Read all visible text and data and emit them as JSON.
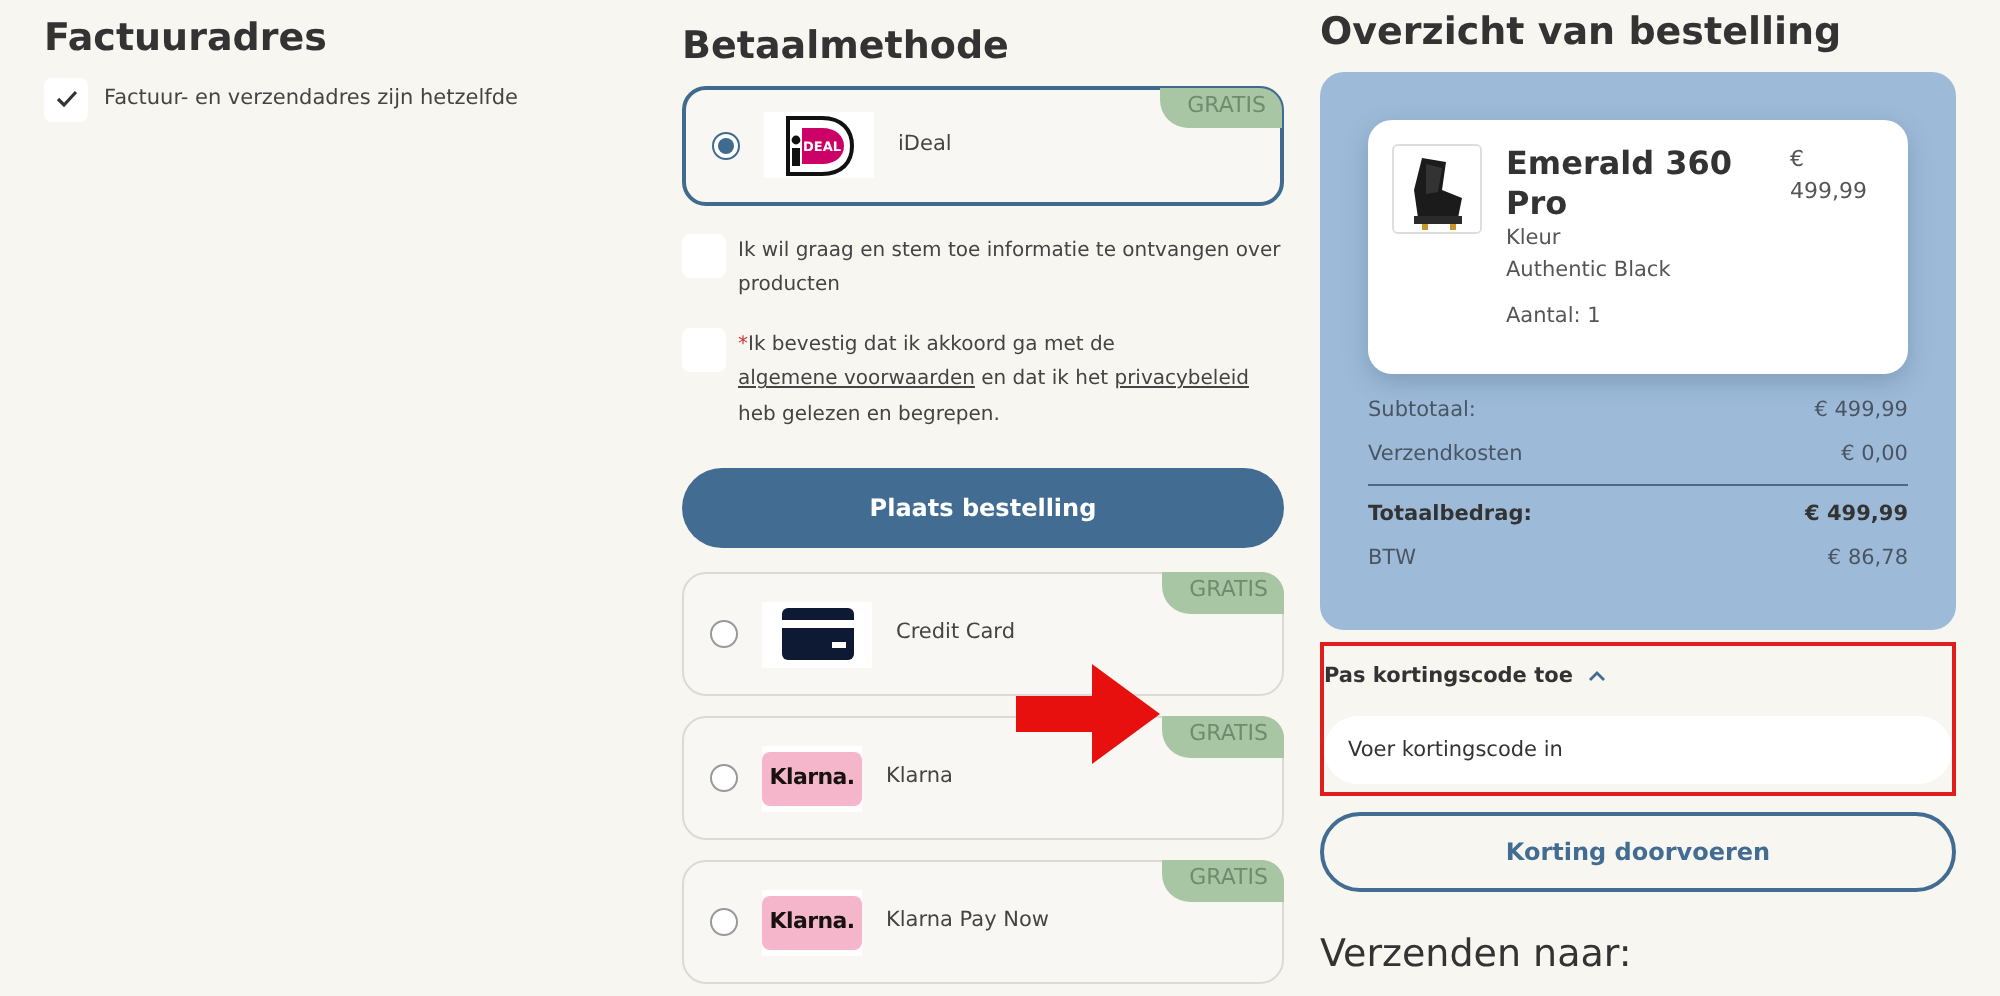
{
  "billing": {
    "title": "Factuuradres",
    "same_address": {
      "label": "Factuur- en verzendadres zijn hetzelfde",
      "checked": true
    }
  },
  "payment": {
    "title": "Betaalmethode",
    "methods": [
      {
        "name": "iDeal",
        "kind": "ideal",
        "logo_text": "DEAL",
        "badge": "GRATIS",
        "selected": true
      },
      {
        "name": "Credit Card",
        "kind": "card",
        "badge": "GRATIS",
        "selected": false
      },
      {
        "name": "Klarna",
        "kind": "klarna",
        "logo_text": "Klarna.",
        "badge": "GRATIS",
        "selected": false
      },
      {
        "name": "Klarna Pay Now",
        "kind": "klarna",
        "logo_text": "Klarna.",
        "badge": "GRATIS",
        "selected": false
      }
    ],
    "consents": [
      {
        "checked": false,
        "parts": [
          {
            "kind": "text",
            "text": "Ik wil graag en stem toe informatie te ontvangen over producten"
          }
        ]
      },
      {
        "checked": false,
        "required_mark": "*",
        "parts": [
          {
            "kind": "text",
            "text": "Ik bevestig dat ik akkoord ga met de "
          },
          {
            "kind": "link",
            "text": "algemene voorwaarden"
          },
          {
            "kind": "text",
            "text": " en dat ik het "
          },
          {
            "kind": "link",
            "text": "privacybeleid"
          },
          {
            "kind": "text",
            "text": " heb gelezen en begrepen."
          }
        ]
      }
    ],
    "place_order_button": "Plaats bestelling"
  },
  "summary": {
    "title": "Overzicht van bestelling",
    "product": {
      "name": "Emerald 360 Pro",
      "price": "€ 499,99",
      "color_label": "Kleur",
      "color_value": "Authentic Black",
      "quantity": "Aantal: 1"
    },
    "totals": [
      {
        "label": "Subtotaal:",
        "value": "€ 499,99",
        "kind": "normal"
      },
      {
        "label": "Verzendkosten",
        "value": "€ 0,00",
        "kind": "normal"
      },
      {
        "label": "Totaalbedrag:",
        "value": "€ 499,99",
        "kind": "total"
      },
      {
        "label": "BTW",
        "value": "€ 86,78",
        "kind": "normal"
      }
    ],
    "discount": {
      "toggle": "Pas kortingscode toe",
      "expanded": true,
      "placeholder": "Voer kortingscode in",
      "button": "Korting doorvoeren"
    },
    "shipping_title": "Verzenden naar:"
  }
}
